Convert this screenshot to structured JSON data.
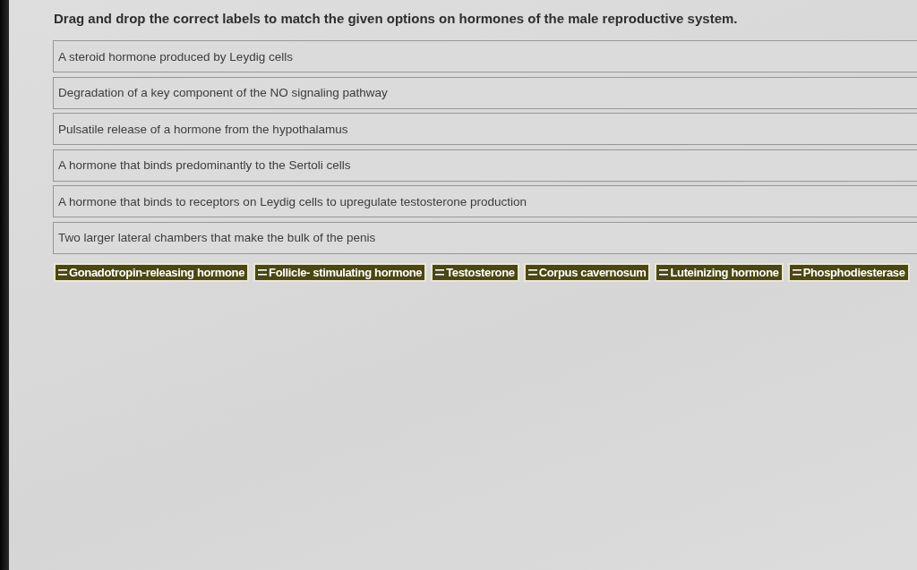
{
  "instruction": "Drag and drop the correct labels to match the given options on hormones of the male reproductive system.",
  "statements": [
    "A steroid hormone produced by Leydig cells",
    "Degradation of a key component of the NO signaling pathway",
    "Pulsatile release of a hormone from the hypothalamus",
    "A hormone that binds predominantly to the Sertoli cells",
    "A hormone that binds to receptors on Leydig cells to upregulate testosterone production",
    "Two larger lateral chambers that make the bulk of the penis"
  ],
  "labels": [
    "Gonadotropin-releasing hormone",
    "Follicle- stimulating hormone",
    "Testosterone",
    "Corpus cavernosum",
    "Luteinizing hormone",
    "Phosphodiesterase"
  ]
}
